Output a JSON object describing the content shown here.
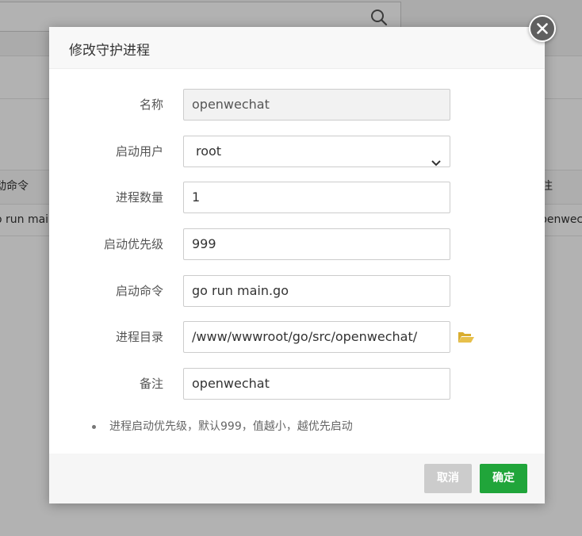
{
  "background": {
    "table_headers": [
      "动命令",
      "注"
    ],
    "table_row": [
      "o run mai",
      "penwec"
    ]
  },
  "dialog": {
    "title": "修改守护进程",
    "fields": [
      {
        "label": "名称",
        "value": "openwechat",
        "readonly": true
      },
      {
        "label": "启动用户",
        "value": "root",
        "type": "select"
      },
      {
        "label": "进程数量",
        "value": "1"
      },
      {
        "label": "启动优先级",
        "value": "999"
      },
      {
        "label": "启动命令",
        "value": "go run main.go"
      },
      {
        "label": "进程目录",
        "value": "/www/wwwroot/go/src/openwechat/"
      },
      {
        "label": "备注",
        "value": "openwechat"
      }
    ],
    "help": [
      "进程启动优先级，默认999，值越小，越优先启动"
    ],
    "buttons": {
      "cancel": "取消",
      "ok": "确定"
    }
  },
  "colors": {
    "primary": "#20a53a",
    "cancel": "#cccccc",
    "folder": "#e7c04b"
  }
}
